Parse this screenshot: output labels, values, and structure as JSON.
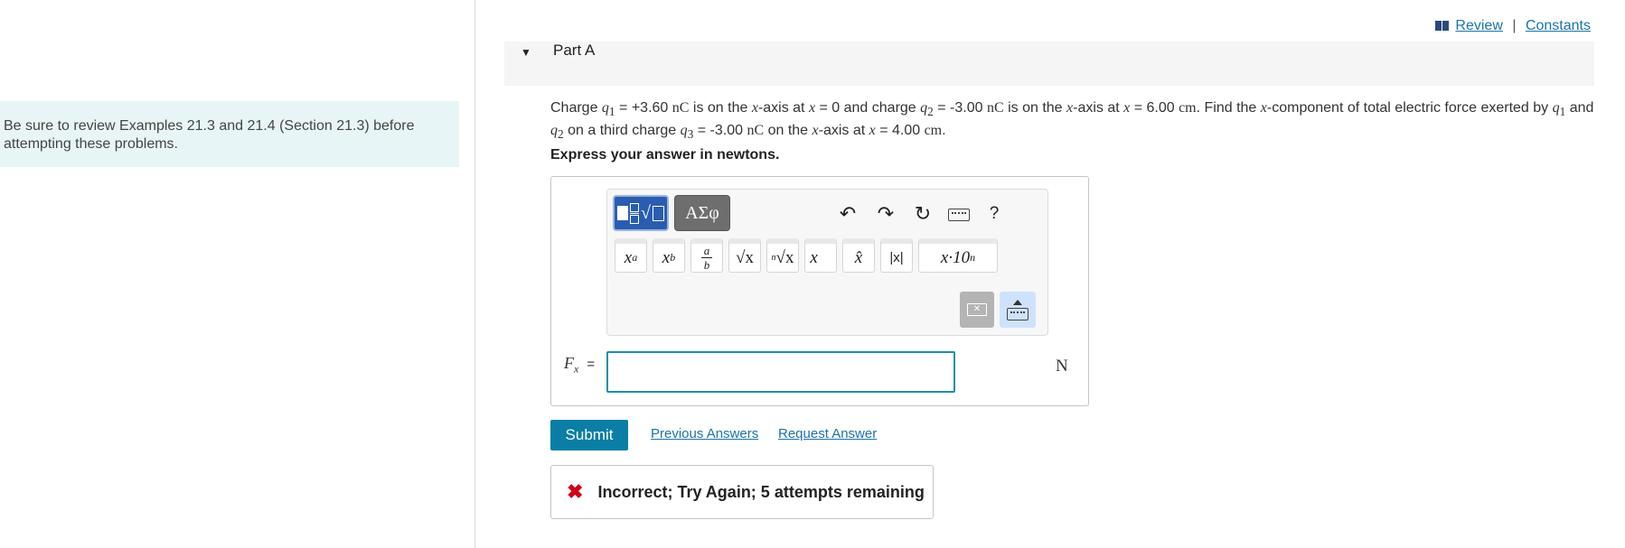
{
  "left_panel": {
    "note_line1": "Be sure to review Examples 21.3 and 21.4 (Section 21.3) before",
    "note_line2": "attempting these problems."
  },
  "top_links": {
    "review": "Review",
    "separator": "|",
    "constants": "Constants"
  },
  "part": {
    "title": "Part A"
  },
  "question": {
    "t1": "Charge ",
    "q1": "q",
    "q1_sub": "1",
    "t2": " = +3.60 ",
    "nC1": "nC",
    "t3": " is on the ",
    "x1": "x",
    "t4": "-axis at ",
    "x2": "x",
    "t5": " = 0 and charge ",
    "q2": "q",
    "q2_sub": "2",
    "t6": " = -3.00 ",
    "nC2": "nC",
    "t7": " is on the ",
    "x3": "x",
    "t8": "-axis at ",
    "x4": "x",
    "t9": " = 6.00 ",
    "cm1": "cm",
    "t10": ". Find the ",
    "x5": "x",
    "t11": "-component of total electric force exerted by ",
    "q1b": "q",
    "q1b_sub": "1",
    "t12": " and ",
    "q2b": "q",
    "q2b_sub": "2",
    "t13": " on a third charge ",
    "q3": "q",
    "q3_sub": "3",
    "t14": " = -3.00 ",
    "nC3": "nC",
    "t15": " on the ",
    "x6": "x",
    "t16": "-axis at ",
    "x7": "x",
    "t17": " = 4.00 ",
    "cm2": "cm",
    "t18": "."
  },
  "instruction": "Express your answer in newtons.",
  "toolbar": {
    "symbols_tab": "ΑΣφ",
    "help": "?",
    "templates": [
      {
        "base": "x",
        "sup": "a"
      },
      {
        "base": "x",
        "sub": "b"
      },
      {
        "num": "a",
        "den": "b"
      },
      {
        "label": "√x"
      },
      {
        "index": "n",
        "label": "√x"
      },
      {
        "label": "x⃗"
      },
      {
        "label": "x̂"
      },
      {
        "label": "|x|"
      },
      {
        "label": "x·10",
        "sup": "n"
      }
    ]
  },
  "answer": {
    "var": "F",
    "var_sub": "x",
    "equals": "=",
    "value": "",
    "unit": "N"
  },
  "actions": {
    "submit": "Submit",
    "previous_answers": "Previous Answers",
    "request_answer": "Request Answer"
  },
  "feedback": {
    "icon": "✖",
    "text": "Incorrect; Try Again; 5 attempts remaining",
    "color": "#d0021b"
  },
  "colors": {
    "accent": "#0a7ea4",
    "link": "#1a73a8",
    "note_bg": "#e7f5f6"
  }
}
